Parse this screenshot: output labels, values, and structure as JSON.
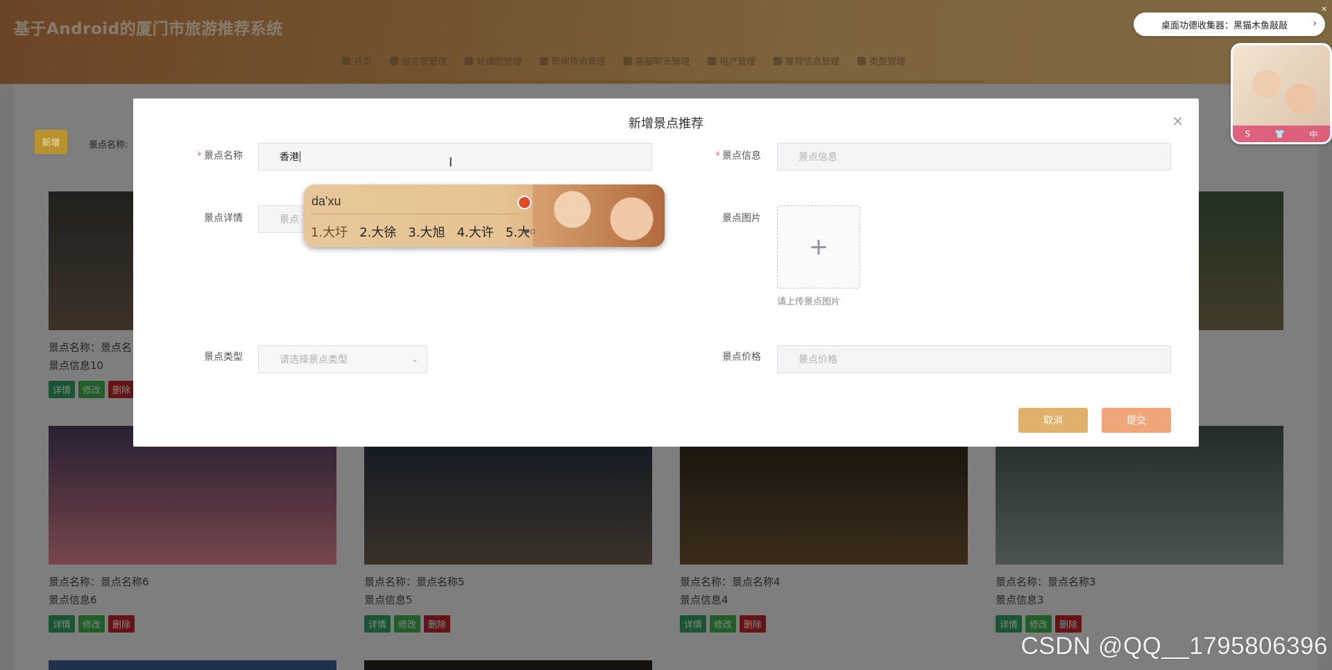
{
  "app": {
    "title": "基于Android的厦门市旅游推荐系统"
  },
  "nav": {
    "items": [
      {
        "label": "首页",
        "icon": "home-icon"
      },
      {
        "label": "留言板管理",
        "icon": "message-icon"
      },
      {
        "label": "轮播图管理",
        "icon": "image-icon"
      },
      {
        "label": "新闻资讯管理",
        "icon": "news-icon"
      },
      {
        "label": "客服聊天管理",
        "icon": "chat-icon"
      },
      {
        "label": "用户管理",
        "icon": "user-icon"
      },
      {
        "label": "推荐信息管理",
        "icon": "list-icon"
      },
      {
        "label": "类型管理",
        "icon": "type-icon"
      }
    ]
  },
  "toolbar": {
    "add_label": "新增",
    "search_label": "景点名称:"
  },
  "cards": [
    {
      "name": "景点名称：景点名",
      "info": "景点信息10",
      "colors": [
        "#3b3a36",
        "#6d5a4a"
      ]
    },
    {
      "name": "",
      "info": "",
      "colors": [
        "#3a5a3a",
        "#7a6a4a"
      ]
    },
    {
      "name": "景点名称：景点名称6",
      "info": "景点信息6",
      "colors": [
        "#4a3a5e",
        "#d8808a"
      ]
    },
    {
      "name": "景点名称：景点名称5",
      "info": "景点信息5",
      "colors": [
        "#1c2a40",
        "#6a5a4a"
      ]
    },
    {
      "name": "景点名称：景点名称4",
      "info": "景点信息4",
      "colors": [
        "#2a2218",
        "#6a5030"
      ]
    },
    {
      "name": "景点名称：景点名称3",
      "info": "景点信息3",
      "colors": [
        "#40504a",
        "#8a9a90"
      ]
    }
  ],
  "card_buttons": {
    "detail": "详情",
    "edit": "修改",
    "delete": "删除"
  },
  "dialog": {
    "title": "新增景点推荐",
    "name_label": "景点名称",
    "name_value": "香港",
    "info_label": "景点信息",
    "info_placeholder": "景点信息",
    "detail_label": "景点详情",
    "detail_placeholder": "景点",
    "image_label": "景点图片",
    "upload_tip": "请上传景点图片",
    "type_label": "景点类型",
    "type_placeholder": "请选择景点类型",
    "price_label": "景点价格",
    "price_placeholder": "景点价格",
    "cancel": "取消",
    "submit": "提交"
  },
  "ime": {
    "input": "da'xu",
    "candidates": [
      "1.大圩",
      "2.大徐",
      "3.大旭",
      "4.大许",
      "5.大"
    ]
  },
  "notification": {
    "text": "桌面功德收集器：黑猫木鱼敲敲"
  },
  "widget": {
    "icons": [
      "S",
      "👕",
      "中"
    ]
  },
  "watermark": "CSDN @QQ__1795806396"
}
